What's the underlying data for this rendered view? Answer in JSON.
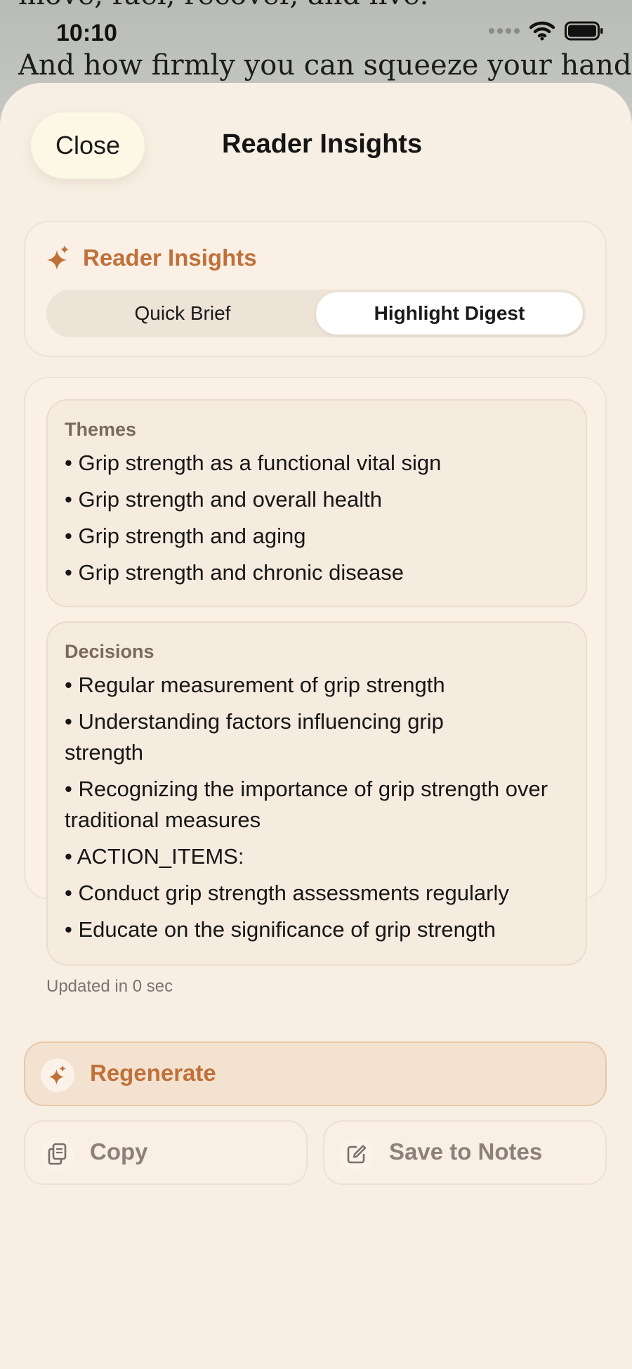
{
  "background": {
    "line_top": "move, fuel, recover, and live.",
    "line": "And how firmly you can squeeze your hand"
  },
  "status_bar": {
    "time": "10:10",
    "signal_icon": "signal-dots-icon",
    "wifi_icon": "wifi-icon",
    "battery_icon": "battery-icon"
  },
  "sheet": {
    "close_label": "Close",
    "title": "Reader Insights"
  },
  "insights_card": {
    "icon": "sparkles-icon",
    "title": "Reader Insights",
    "segments": [
      "Quick Brief",
      "Highlight Digest"
    ],
    "selected_segment": "Highlight Digest"
  },
  "digest": {
    "themes": {
      "label": "Themes",
      "items": [
        "• Grip strength as a functional vital sign",
        "• Grip strength and overall health",
        "• Grip strength and aging",
        "• Grip strength and chronic disease"
      ]
    },
    "decisions": {
      "label": "Decisions",
      "items": [
        "• Regular measurement of grip strength",
        "• Understanding factors influencing grip strength",
        "• Recognizing the importance of grip strength over traditional measures",
        "• ACTION_ITEMS:",
        "• Conduct grip strength assessments regularly",
        "• Educate on the significance of grip strength"
      ]
    },
    "updated": "Updated in 0 sec"
  },
  "actions": {
    "regenerate": "Regenerate",
    "copy": "Copy",
    "save": "Save to Notes"
  },
  "colors": {
    "accent": "#c0713a",
    "sheet_bg": "#f8efe4"
  }
}
